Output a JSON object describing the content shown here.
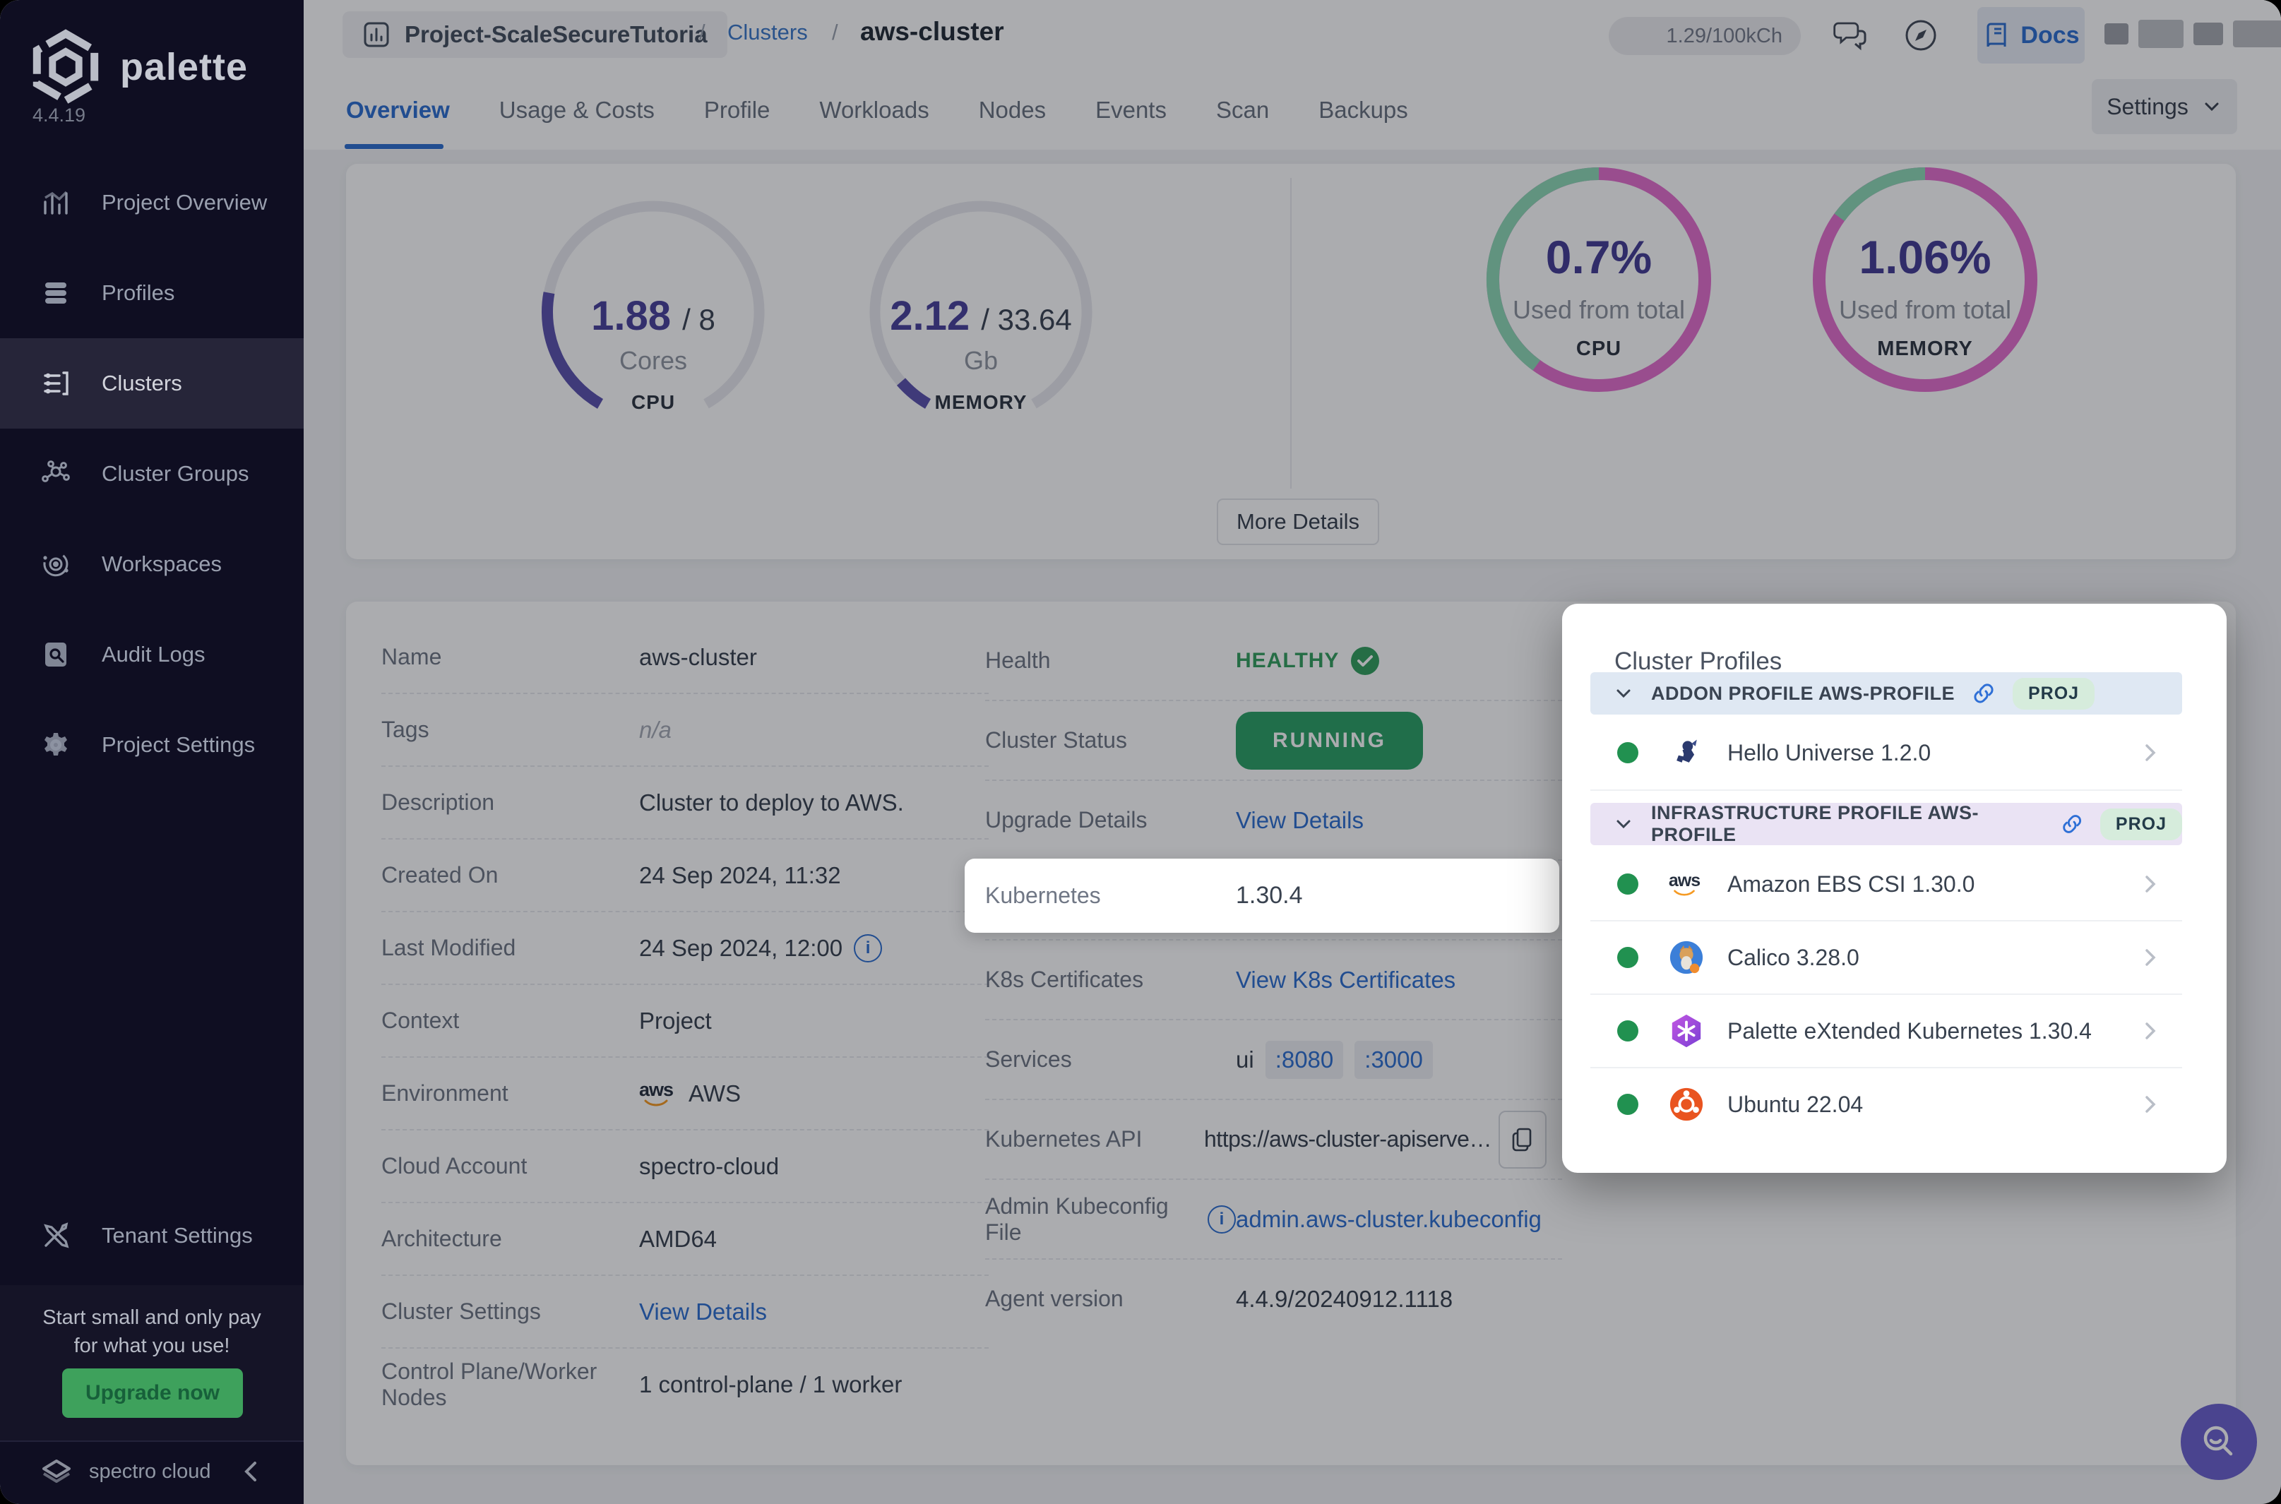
{
  "app": {
    "brand": "palette",
    "version": "4.4.19",
    "footer_brand": "spectro cloud"
  },
  "colors": {
    "sidebar_bg": "#0f0e22",
    "accent_blue": "#2e6fd0",
    "indigo": "#5b52ad",
    "donut_magenta": "#e46fcd",
    "donut_green": "#8fd9b6",
    "green_running": "#2ca167",
    "green_healthy": "#35a05f",
    "upgrade_green": "#3ea15c",
    "status_dot_green": "#219150"
  },
  "sidebar": {
    "items": [
      {
        "label": "Project Overview"
      },
      {
        "label": "Profiles"
      },
      {
        "label": "Clusters"
      },
      {
        "label": "Cluster Groups"
      },
      {
        "label": "Workspaces"
      },
      {
        "label": "Audit Logs"
      },
      {
        "label": "Project Settings"
      }
    ],
    "tenant_settings_label": "Tenant Settings",
    "promo_line1": "Start small and only pay",
    "promo_line2": "for what you use!",
    "upgrade_button": "Upgrade now"
  },
  "topbar": {
    "project_name": "Project-ScaleSecureTutoria",
    "sep1": "/",
    "sep2": "/",
    "breadcrumb_parent": "Clusters",
    "page_title": "aws-cluster",
    "credits_badge": "1.29/100kCh",
    "docs_label": "Docs"
  },
  "tabs": {
    "items": [
      "Overview",
      "Usage & Costs",
      "Profile",
      "Workloads",
      "Nodes",
      "Events",
      "Scan",
      "Backups"
    ],
    "active": "Overview",
    "settings_button": "Settings"
  },
  "overview": {
    "cpu_gauge": {
      "used": "1.88",
      "total": "/ 8",
      "unit": "Cores",
      "title": "CPU"
    },
    "memory_gauge": {
      "used": "2.12",
      "total": "/ 33.64",
      "unit": "Gb",
      "title": "MEMORY"
    },
    "cpu_donut": {
      "value": "0.7%",
      "caption": "Used from total",
      "title": "CPU"
    },
    "memory_donut": {
      "value": "1.06%",
      "caption": "Used from total",
      "title": "MEMORY"
    },
    "more_details_button": "More Details"
  },
  "chart_data": [
    {
      "type": "gauge",
      "title": "CPU",
      "used": 1.88,
      "total": 8,
      "unit": "Cores",
      "fraction": 0.235
    },
    {
      "type": "gauge",
      "title": "MEMORY",
      "used": 2.12,
      "total": 33.64,
      "unit": "Gb",
      "fraction": 0.063
    },
    {
      "type": "donut",
      "title": "CPU",
      "value_pct": 0.7,
      "caption": "Used from total",
      "segments": [
        {
          "color": "green",
          "pct": 40
        },
        {
          "color": "magenta",
          "pct": 60
        }
      ]
    },
    {
      "type": "donut",
      "title": "MEMORY",
      "value_pct": 1.06,
      "caption": "Used from total",
      "segments": [
        {
          "color": "green",
          "pct": 15
        },
        {
          "color": "magenta",
          "pct": 85
        }
      ]
    }
  ],
  "details": {
    "left": [
      {
        "label": "Name",
        "value": "aws-cluster"
      },
      {
        "label": "Tags",
        "value": "n/a"
      },
      {
        "label": "Description",
        "value": "Cluster to deploy to AWS."
      },
      {
        "label": "Created On",
        "value": "24 Sep 2024, 11:32"
      },
      {
        "label": "Last Modified",
        "value": "24 Sep 2024, 12:00"
      },
      {
        "label": "Context",
        "value": "Project"
      },
      {
        "label": "Environment",
        "value": "AWS"
      },
      {
        "label": "Cloud Account",
        "value": "spectro-cloud"
      },
      {
        "label": "Architecture",
        "value": "AMD64"
      },
      {
        "label": "Cluster Settings",
        "value": "View Details"
      },
      {
        "label": "Control Plane/Worker Nodes",
        "value": "1 control-plane / 1 worker"
      }
    ],
    "right": {
      "health_label": "Health",
      "health_value": "HEALTHY",
      "status_label": "Cluster Status",
      "status_value": "RUNNING",
      "upgrade_label": "Upgrade Details",
      "upgrade_value": "View Details",
      "kubernetes_label": "Kubernetes",
      "kubernetes_value": "1.30.4",
      "certs_label": "K8s Certificates",
      "certs_value": "View K8s Certificates",
      "services_label": "Services",
      "services_prefix": "ui",
      "services_ports": [
        ":8080",
        ":3000"
      ],
      "api_label": "Kubernetes API",
      "api_value": "https://aws-cluster-apiserve…",
      "kubeconfig_label": "Admin Kubeconfig File",
      "kubeconfig_value": "admin.aws-cluster.kubeconfig",
      "agent_label": "Agent version",
      "agent_value": "4.4.9/20240912.1118"
    }
  },
  "profiles_panel": {
    "title": "Cluster Profiles",
    "sections": [
      {
        "header": "ADDON PROFILE AWS-PROFILE",
        "badge": "PROJ",
        "items": [
          {
            "name": "Hello Universe 1.2.0",
            "icon": "hello-universe-icon"
          }
        ]
      },
      {
        "header": "INFRASTRUCTURE PROFILE AWS-PROFILE",
        "badge": "PROJ",
        "items": [
          {
            "name": "Amazon EBS CSI 1.30.0",
            "icon": "aws-icon"
          },
          {
            "name": "Calico 3.28.0",
            "icon": "calico-icon"
          },
          {
            "name": "Palette eXtended Kubernetes 1.30.4",
            "icon": "palette-k8s-icon"
          },
          {
            "name": "Ubuntu 22.04",
            "icon": "ubuntu-icon"
          }
        ]
      }
    ]
  }
}
